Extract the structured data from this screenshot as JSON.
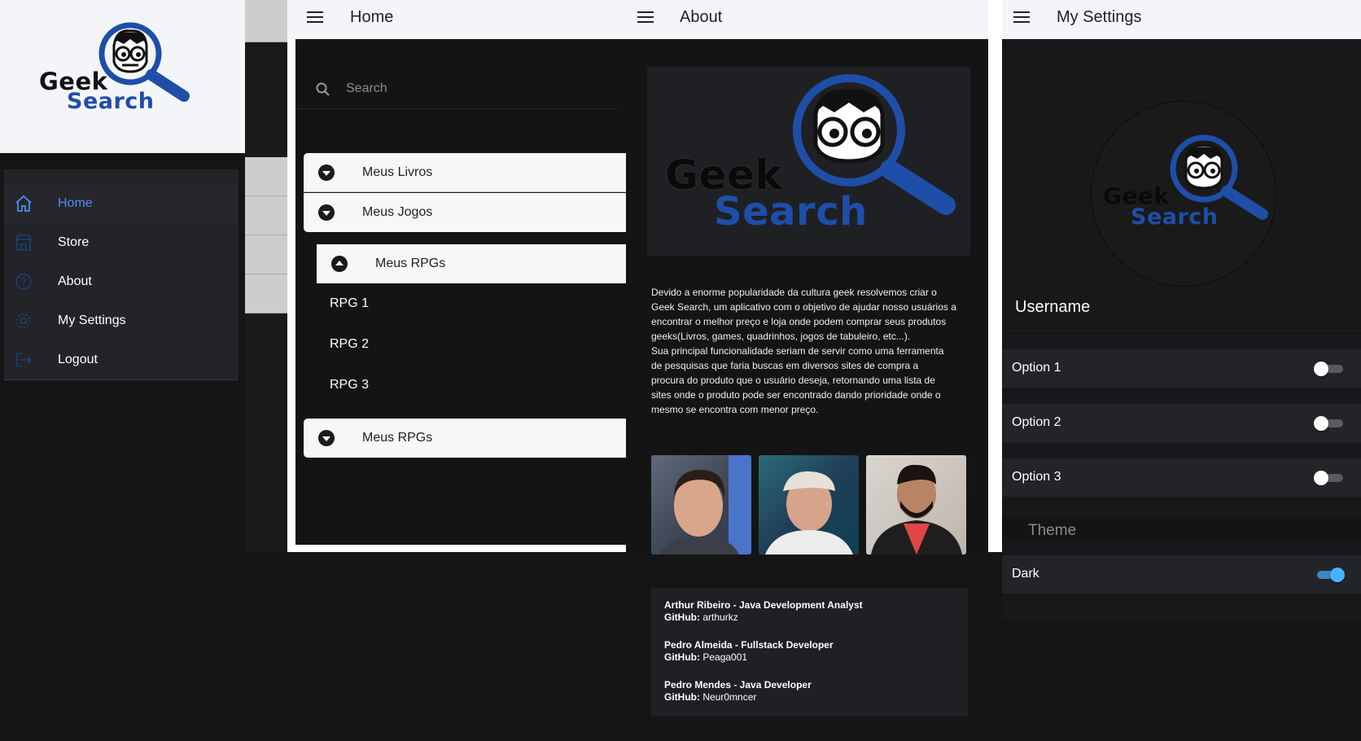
{
  "logo": {
    "word1": "Geek",
    "word2": "Search"
  },
  "side_menu": {
    "items": [
      {
        "label": "Home",
        "icon": "home-icon",
        "active": true
      },
      {
        "label": "Store",
        "icon": "store-icon",
        "active": false
      },
      {
        "label": "About",
        "icon": "help-circle-icon",
        "active": false
      },
      {
        "label": "My Settings",
        "icon": "gear-icon",
        "active": false
      },
      {
        "label": "Logout",
        "icon": "logout-icon",
        "active": false
      }
    ]
  },
  "home": {
    "title": "Home",
    "search_placeholder": "Search",
    "accordion": {
      "item1": "Meus Livros",
      "item2": "Meus Jogos",
      "item3": "Meus RPGs",
      "item4": "Meus RPGs"
    },
    "rpgs": [
      "RPG 1",
      "RPG 2",
      "RPG 3"
    ]
  },
  "about": {
    "title": "About",
    "description_lines": [
      "Devido a enorme popularidade da cultura geek resolvemos criar o",
      "Geek Search, um aplicativo com o objetivo de ajudar nosso usuários a",
      "encontrar o melhor preço e loja onde podem comprar seus produtos",
      "geeks(Livros, games, quadrinhos, jogos de tabuleiro, etc...).",
      "Sua principal funcionalidade seriam de servir como uma ferramenta",
      "de pesquisas que faria buscas em diversos sites de compra a",
      "procura do produto que o usuário deseja, retornando uma lista de",
      "sites onde o produto pode ser encontrado dando prioridade onde o",
      "mesmo se encontra com menor preço."
    ],
    "team": [
      {
        "name": "Arthur Ribeiro - Java Development Analyst",
        "github_label": "GitHub:",
        "github": "arthurkz"
      },
      {
        "name": "Pedro Almeida - Fullstack Developer",
        "github_label": "GitHub:",
        "github": "Peaga001"
      },
      {
        "name": "Pedro Mendes - Java Developer",
        "github_label": "GitHub:",
        "github": "Neur0mncer"
      }
    ]
  },
  "settings": {
    "title": "My Settings",
    "username": "Username",
    "options": [
      {
        "label": "Option 1",
        "on": false
      },
      {
        "label": "Option 2",
        "on": false
      },
      {
        "label": "Option 3",
        "on": false
      }
    ],
    "theme_header": "Theme",
    "theme_option": {
      "label": "Dark",
      "on": true
    }
  },
  "colors": {
    "brand_blue": "#1e4ea8",
    "active_blue": "#4d8ef7",
    "toggle_on": "#4bb1ff",
    "dark_bg": "#141415",
    "light_bar": "#f4f5f8"
  }
}
